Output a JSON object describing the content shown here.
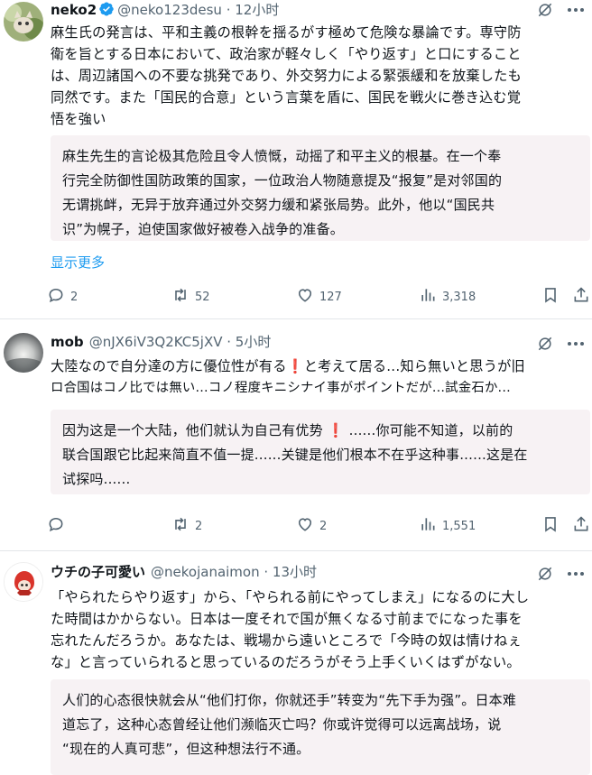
{
  "tweets": [
    {
      "display_name": "neko2",
      "handle_time": "@neko123desu · 12小时",
      "original": [
        "麻生氏の発言は、平和主義の根幹を揺るがす極めて危険な暴論です。専守防",
        "衛を旨とする日本において、政治家が軽々しく「やり返す」と口にすること",
        "は、周辺諸国への不要な挑発であり、外交努力による緊張緩和を放棄したも",
        "同然です。また「国民的合意」という言葉を盾に、国民を戦火に巻き込む覚",
        "悟を強い"
      ],
      "translation": [
        "麻生先生的言论极其危险且令人愤慨，动摇了和平主义的根基。在一个奉",
        "行完全防御性国防政策的国家，一位政治人物随意提及“报复”是对邻国的",
        "无谓挑衅，无异于放弃通过外交努力缓和紧张局势。此外，他以“国民共",
        "识”为幌子，迫使国家做好被卷入战争的准备。"
      ],
      "show_more": "显示更多",
      "replies": "2",
      "retweets": "52",
      "likes": "127",
      "views": "3,318"
    },
    {
      "display_name": "mob",
      "handle_time": "@nJX6iV3Q2KC5jXV · 5小时",
      "original_1a": "大陸なので自分達の方に優位性が有る",
      "original_1mark": "❗",
      "original_1b": "と考えて居る...知ら無いと思うが旧",
      "original_2": "ロ合国はコノ比では無い...コノ程度キニシナイ事がポイントだが...試金石か...",
      "translation_1a": "因为这是一个大陆，他们就认为自己有优势",
      "translation_1mark": "❗",
      "translation_1b": "......你可能不知道，以前的",
      "translation_2": "联合国跟它比起来简直不值一提......关键是他们根本不在乎这种事......这是在",
      "translation_3": "试探吗......",
      "replies": "",
      "retweets": "2",
      "likes": "2",
      "views": "1,551"
    },
    {
      "display_name": "ウチの子可愛い",
      "handle_time": "@nekojanaimon · 13小时",
      "original": [
        "「やられたらやり返す」から、「やられる前にやってしまえ」になるのに大し",
        "た時間はかからない。日本は一度それで国が無くなる寸前までになった事を",
        "忘れたんだろうか。あなたは、戦場から遠いところで「今時の奴は情けねぇ",
        "な」と言っていられると思っているのだろうがそう上手くいくはずがない。"
      ],
      "translation": [
        "人们的心态很快就会从“他们打你，你就还手”转变为“先下手为强”。日本难",
        "道忘了，这种心态曾经让他们濒临灭亡吗？你或许觉得可以远离战场，说",
        "“现在的人真可悲”，但这种想法行不通。"
      ]
    }
  ],
  "colors": {
    "accent": "#1d9bf0",
    "verified": "#1d9bf0",
    "muted": "#536471",
    "translation_bg": "#f7f2f4",
    "exclaim": "#e0245e"
  },
  "icons": [
    "grok-icon",
    "more-icon",
    "reply-icon",
    "retweet-icon",
    "like-icon",
    "views-icon",
    "bookmark-icon",
    "share-icon",
    "verified-badge-icon"
  ]
}
